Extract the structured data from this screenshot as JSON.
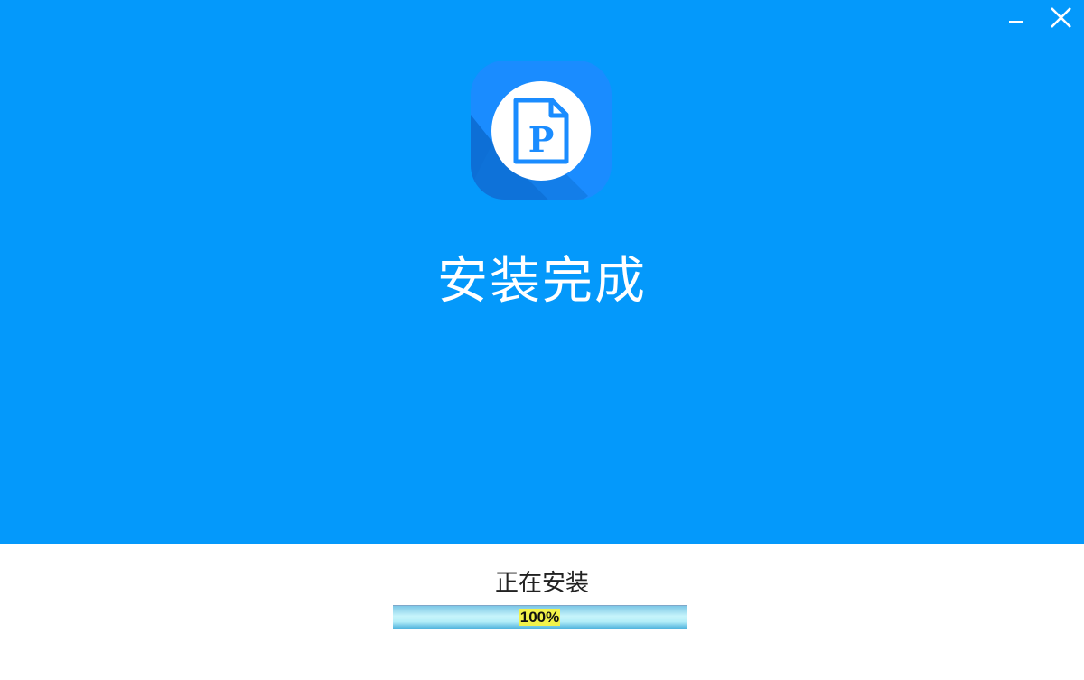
{
  "window": {
    "minimize_icon": "minimize-icon",
    "close_icon": "close-icon"
  },
  "colors": {
    "background_blue": "#0499fb",
    "icon_blue": "#1a8cff",
    "text_white": "#ffffff"
  },
  "app": {
    "icon": "pdf-document-p-icon",
    "icon_letter": "P"
  },
  "title": "安装完成",
  "status": {
    "text": "正在安装"
  },
  "progress": {
    "value": 1.0,
    "label": "100%"
  }
}
